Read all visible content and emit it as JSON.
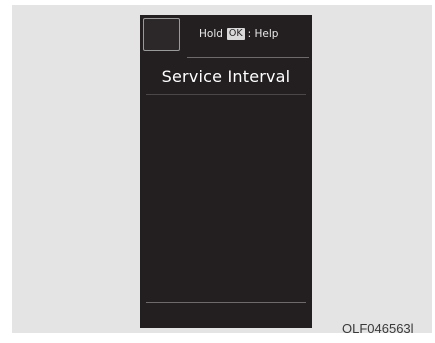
{
  "screen": {
    "hint": {
      "prefix": "Hold",
      "key": "OK",
      "suffix": ": Help"
    },
    "title": "Service Interval",
    "icon": "blank-icon"
  },
  "figure_code": "OLF046563l",
  "colors": {
    "screen_bg": "#231f20",
    "bezel_bg": "#e4e4e4",
    "text": "#ffffff",
    "key_bg": "#d9d9d9"
  }
}
